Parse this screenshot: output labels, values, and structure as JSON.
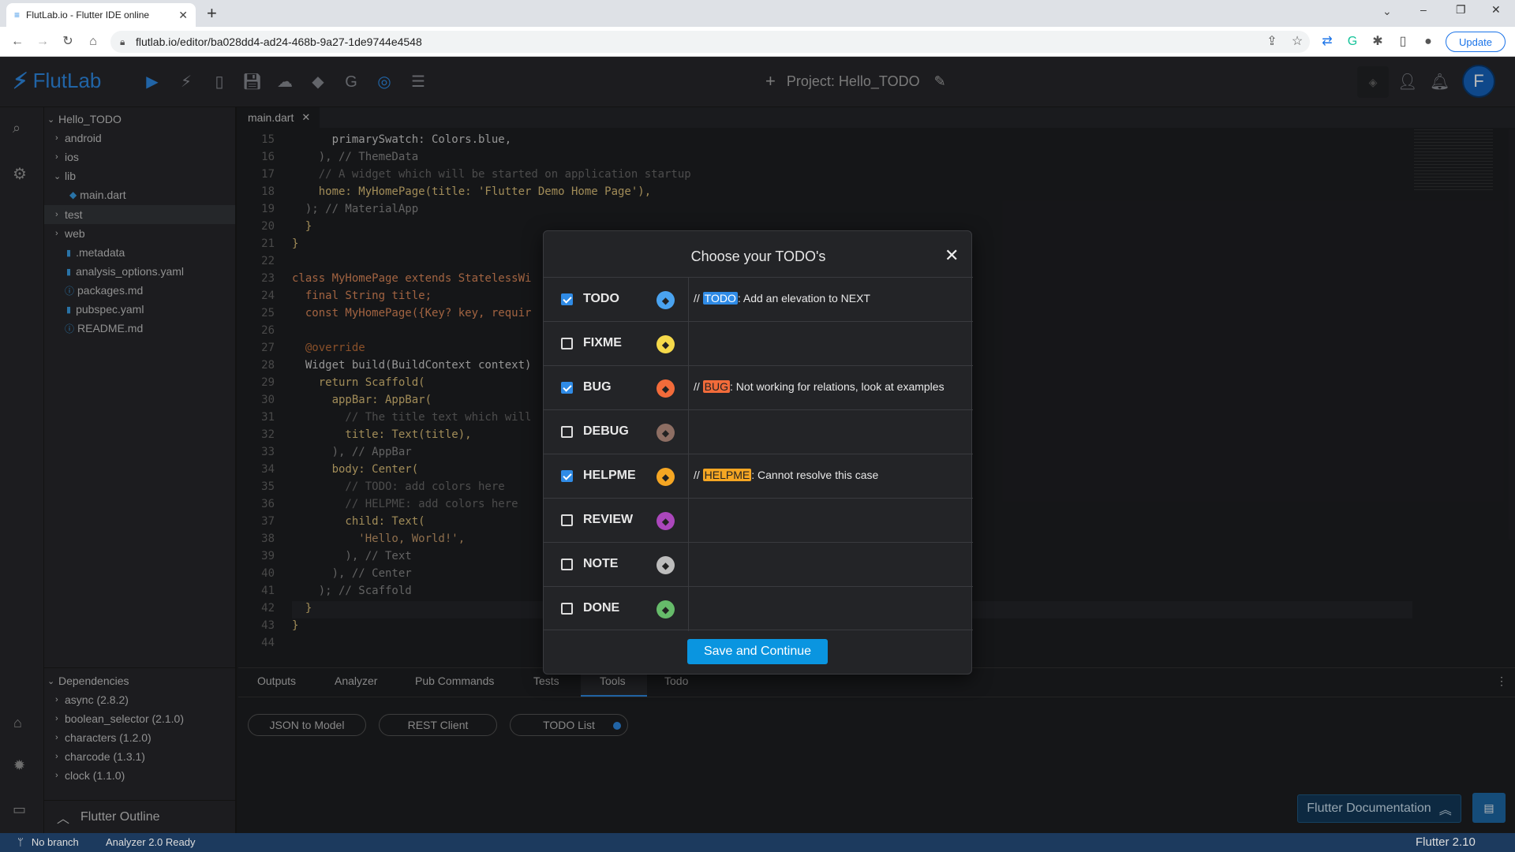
{
  "browser": {
    "tab_title": "FlutLab.io - Flutter IDE online",
    "new_tab": "+",
    "url": "flutlab.io/editor/ba028dd4-ad24-468b-9a27-1de9744e4548",
    "update_label": "Update"
  },
  "app": {
    "logo_text": "FlutLab",
    "project_title": "Project: Hello_TODO",
    "avatar_letter": "F"
  },
  "explorer": {
    "root": "Hello_TODO",
    "items": [
      {
        "label": "android",
        "kind": "folder"
      },
      {
        "label": "ios",
        "kind": "folder"
      },
      {
        "label": "lib",
        "kind": "folder-open"
      },
      {
        "label": "main.dart",
        "kind": "dart"
      },
      {
        "label": "test",
        "kind": "folder"
      },
      {
        "label": "web",
        "kind": "folder"
      },
      {
        "label": ".metadata",
        "kind": "file"
      },
      {
        "label": "analysis_options.yaml",
        "kind": "file"
      },
      {
        "label": "packages.md",
        "kind": "info"
      },
      {
        "label": "pubspec.yaml",
        "kind": "file"
      },
      {
        "label": "README.md",
        "kind": "info"
      }
    ],
    "dependencies_title": "Dependencies",
    "dependencies": [
      "async (2.8.2)",
      "boolean_selector (2.1.0)",
      "characters (1.2.0)",
      "charcode (1.3.1)",
      "clock (1.1.0)"
    ],
    "outline_title": "Flutter Outline"
  },
  "editor": {
    "tab": "main.dart",
    "lines": [
      {
        "n": "15",
        "code": "      primarySwatch: Colors.blue,"
      },
      {
        "n": "16",
        "code": "    ), // ThemeData"
      },
      {
        "n": "17",
        "code": "    // A widget which will be started on application startup"
      },
      {
        "n": "18",
        "code": "    home: MyHomePage(title: 'Flutter Demo Home Page'),"
      },
      {
        "n": "19",
        "code": "  ); // MaterialApp"
      },
      {
        "n": "20",
        "code": "  }"
      },
      {
        "n": "21",
        "code": "}"
      },
      {
        "n": "22",
        "code": ""
      },
      {
        "n": "23",
        "code": "class MyHomePage extends StatelessWi"
      },
      {
        "n": "24",
        "code": "  final String title;"
      },
      {
        "n": "25",
        "code": "  const MyHomePage({Key? key, requir"
      },
      {
        "n": "26",
        "code": ""
      },
      {
        "n": "27",
        "code": "  @override"
      },
      {
        "n": "28",
        "code": "  Widget build(BuildContext context)"
      },
      {
        "n": "29",
        "code": "    return Scaffold("
      },
      {
        "n": "30",
        "code": "      appBar: AppBar("
      },
      {
        "n": "31",
        "code": "        // The title text which will"
      },
      {
        "n": "32",
        "code": "        title: Text(title),"
      },
      {
        "n": "33",
        "code": "      ), // AppBar"
      },
      {
        "n": "34",
        "code": "      body: Center("
      },
      {
        "n": "35",
        "code": "        // TODO: add colors here"
      },
      {
        "n": "36",
        "code": "        // HELPME: add colors here"
      },
      {
        "n": "37",
        "code": "        child: Text("
      },
      {
        "n": "38",
        "code": "          'Hello, World!',"
      },
      {
        "n": "39",
        "code": "        ), // Text"
      },
      {
        "n": "40",
        "code": "      ), // Center"
      },
      {
        "n": "41",
        "code": "    ); // Scaffold"
      },
      {
        "n": "42",
        "code": "  }"
      },
      {
        "n": "43",
        "code": "}"
      },
      {
        "n": "44",
        "code": ""
      }
    ]
  },
  "bottom_panel": {
    "tabs": [
      "Outputs",
      "Analyzer",
      "Pub Commands",
      "Tests",
      "Tools",
      "Todo"
    ],
    "active_tab": "Tools",
    "tools": [
      "JSON to Model",
      "REST Client",
      "TODO List"
    ]
  },
  "floating": {
    "docs_label": "Flutter Documentation"
  },
  "statusbar": {
    "branch": "No branch",
    "analyzer": "Analyzer 2.0 Ready",
    "flutter_version": "Flutter 2.10"
  },
  "modal": {
    "title": "Choose your TODO's",
    "save_label": "Save and Continue",
    "rows": [
      {
        "name": "TODO",
        "checked": true,
        "color": "#4aa3f0",
        "preview_prefix": "// ",
        "preview_tag": "TODO",
        "preview_text": ": Add an elevation to NEXT"
      },
      {
        "name": "FIXME",
        "checked": false,
        "color": "#f5d94a",
        "preview_prefix": "",
        "preview_tag": "",
        "preview_text": ""
      },
      {
        "name": "BUG",
        "checked": true,
        "color": "#f26b3a",
        "preview_prefix": "// ",
        "preview_tag": "BUG",
        "preview_text": ": Not working for relations, look at examples"
      },
      {
        "name": "DEBUG",
        "checked": false,
        "color": "#8d6e63",
        "preview_prefix": "",
        "preview_tag": "",
        "preview_text": ""
      },
      {
        "name": "HELPME",
        "checked": true,
        "color": "#f5a623",
        "preview_prefix": "// ",
        "preview_tag": "HELPME",
        "preview_text": ": Cannot resolve this case"
      },
      {
        "name": "REVIEW",
        "checked": false,
        "color": "#ab47bc",
        "preview_prefix": "",
        "preview_tag": "",
        "preview_text": ""
      },
      {
        "name": "NOTE",
        "checked": false,
        "color": "#bdbdbd",
        "preview_prefix": "",
        "preview_tag": "",
        "preview_text": ""
      },
      {
        "name": "DONE",
        "checked": false,
        "color": "#66bb6a",
        "preview_prefix": "",
        "preview_tag": "",
        "preview_text": ""
      }
    ]
  }
}
